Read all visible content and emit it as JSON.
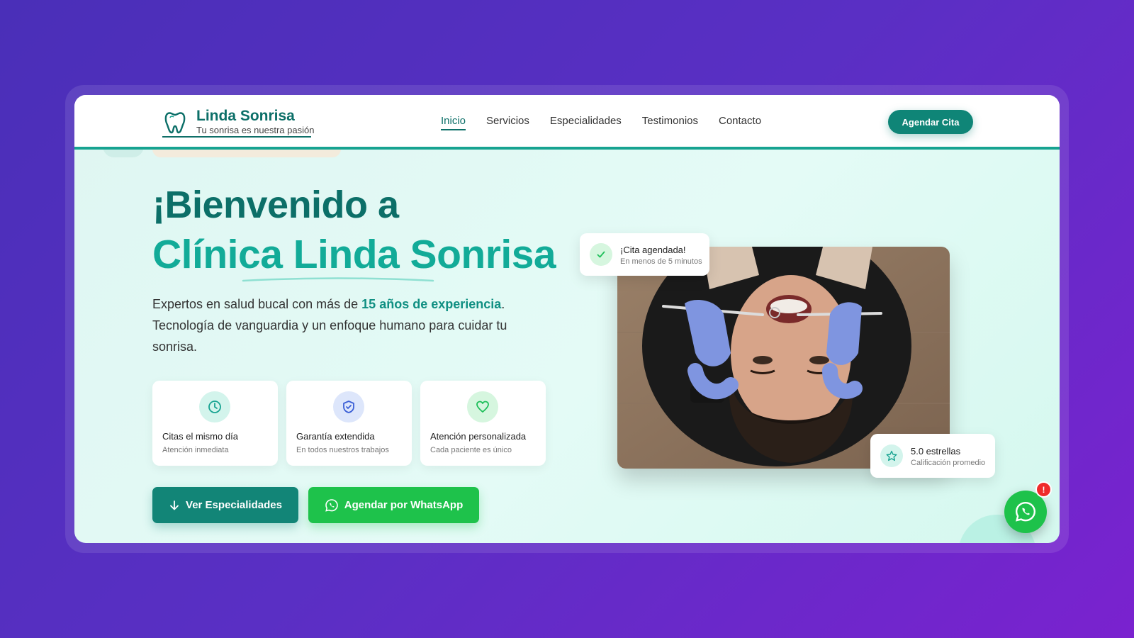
{
  "brand": {
    "name": "Linda Sonrisa",
    "tagline": "Tu sonrisa es nuestra pasión"
  },
  "nav": {
    "items": [
      {
        "label": "Inicio",
        "active": true
      },
      {
        "label": "Servicios",
        "active": false
      },
      {
        "label": "Especialidades",
        "active": false
      },
      {
        "label": "Testimonios",
        "active": false
      },
      {
        "label": "Contacto",
        "active": false
      }
    ],
    "cta_label": "Agendar Cita"
  },
  "hero": {
    "heading_line1": "¡Bienvenido a",
    "heading_line2": "Clínica Linda Sonrisa",
    "desc_before": "Expertos en salud bucal con más de ",
    "desc_highlight": "15 años de experiencia",
    "desc_after": ". Tecnología de vanguardia y un enfoque humano para cuidar tu sonrisa."
  },
  "features": [
    {
      "icon": "clock-icon",
      "title": "Citas el mismo día",
      "subtitle": "Atención inmediata",
      "color": "#17a391"
    },
    {
      "icon": "shield-check-icon",
      "title": "Garantía extendida",
      "subtitle": "En todos nuestros trabajos",
      "color": "#3b5fd6"
    },
    {
      "icon": "heart-icon",
      "title": "Atención personalizada",
      "subtitle": "Cada paciente es único",
      "color": "#1fbf5a"
    }
  ],
  "buttons": {
    "especialidades": "Ver Especialidades",
    "whatsapp": "Agendar por WhatsApp"
  },
  "floating": {
    "appointment_title": "¡Cita agendada!",
    "appointment_sub": "En menos de 5 minutos",
    "rating_title": "5.0 estrellas",
    "rating_sub": "Calificación promedio"
  },
  "whatsapp_badge": "!",
  "colors": {
    "primary": "#0c6f68",
    "accent": "#12ab98",
    "whatsapp": "#1ec24b",
    "background_start": "#4a2fb8",
    "background_end": "#7a22cf"
  }
}
